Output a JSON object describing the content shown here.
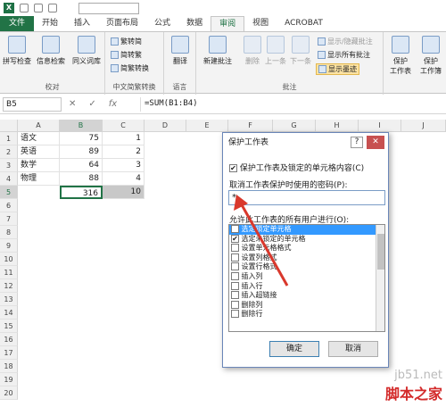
{
  "quick_access": {
    "app_icon": "X"
  },
  "tabs": [
    "文件",
    "开始",
    "插入",
    "页面布局",
    "公式",
    "数据",
    "审阅",
    "视图",
    "ACROBAT"
  ],
  "active_tab": "审阅",
  "ribbon": {
    "proofing": {
      "label": "校对",
      "buttons": [
        "拼写检查",
        "信息检索",
        "同义词库"
      ]
    },
    "chinese": {
      "label": "中文简繁转换",
      "buttons": [
        "繁转简",
        "简转繁",
        "简繁转换"
      ]
    },
    "language": {
      "label": "语言",
      "buttons": [
        "翻译"
      ]
    },
    "comments": {
      "label": "批注",
      "new_comment": "新建批注",
      "delete": "删除",
      "prev": "上一条",
      "next": "下一条",
      "show_hide": "显示/隐藏批注",
      "show_all": "显示所有批注",
      "show_ink": "显示墨迹"
    },
    "protect": {
      "buttons": [
        "保护",
        "工作表",
        "保护",
        "工作簿"
      ]
    }
  },
  "formula_bar": {
    "name_box": "B5",
    "formula": "=SUM(B1:B4)",
    "fx": "fx"
  },
  "columns": [
    "A",
    "B",
    "C",
    "D",
    "E",
    "F",
    "G",
    "H",
    "I",
    "J"
  ],
  "rows": [
    {
      "num": "1",
      "a": "语文",
      "b": "75",
      "c": "1"
    },
    {
      "num": "2",
      "a": "英语",
      "b": "89",
      "c": "2"
    },
    {
      "num": "3",
      "a": "数学",
      "b": "64",
      "c": "3"
    },
    {
      "num": "4",
      "a": "物理",
      "b": "88",
      "c": "4"
    },
    {
      "num": "5",
      "a": "",
      "b": "316",
      "c": "10"
    },
    {
      "num": "6"
    },
    {
      "num": "7"
    },
    {
      "num": "8"
    },
    {
      "num": "9"
    },
    {
      "num": "10"
    },
    {
      "num": "11"
    },
    {
      "num": "12"
    },
    {
      "num": "13"
    },
    {
      "num": "14"
    },
    {
      "num": "15"
    },
    {
      "num": "16"
    },
    {
      "num": "17"
    },
    {
      "num": "18"
    },
    {
      "num": "19"
    },
    {
      "num": "20"
    }
  ],
  "dialog": {
    "title": "保护工作表",
    "help": "?",
    "close": "✕",
    "protect_checkbox": "保护工作表及锁定的单元格内容(C)",
    "password_label": "取消工作表保护时使用的密码(P):",
    "password_value": "*",
    "allow_label": "允许此工作表的所有用户进行(O):",
    "permissions": [
      {
        "label": "选定锁定单元格",
        "checked": true
      },
      {
        "label": "选定未锁定的单元格",
        "checked": true
      },
      {
        "label": "设置单元格格式",
        "checked": false
      },
      {
        "label": "设置列格式",
        "checked": false
      },
      {
        "label": "设置行格式",
        "checked": false
      },
      {
        "label": "插入列",
        "checked": false
      },
      {
        "label": "插入行",
        "checked": false
      },
      {
        "label": "插入超链接",
        "checked": false
      },
      {
        "label": "删除列",
        "checked": false
      },
      {
        "label": "删除行",
        "checked": false
      }
    ],
    "ok": "确定",
    "cancel": "取消"
  },
  "watermark": {
    "url": "jb51.net",
    "text": "脚本之家"
  }
}
